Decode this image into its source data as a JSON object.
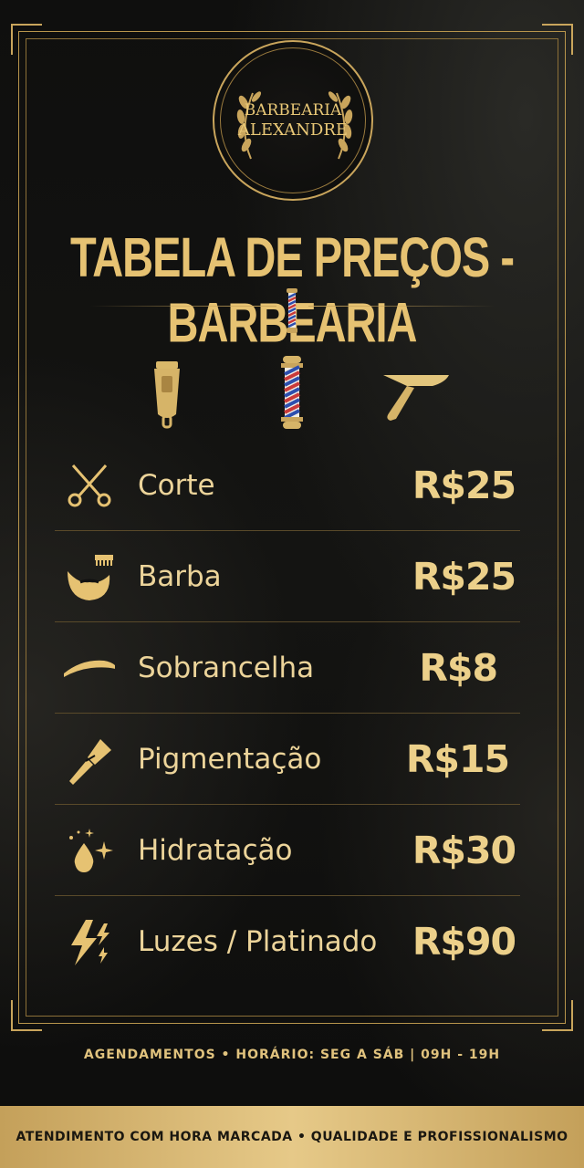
{
  "logo": {
    "line1": "BARBEARIA",
    "line2": "ALEXANDRE"
  },
  "title": "TABELA DE PREÇOS - BARBEARIA",
  "services": [
    {
      "name": "Corte",
      "price": "R$25",
      "icon": "scissors-icon"
    },
    {
      "name": "Barba",
      "price": "R$25",
      "icon": "beard-comb-icon"
    },
    {
      "name": "Sobrancelha",
      "price": "R$8",
      "icon": "eyebrow-icon"
    },
    {
      "name": "Pigmentação",
      "price": "R$15",
      "icon": "brush-icon"
    },
    {
      "name": "Hidratação",
      "price": "R$30",
      "icon": "droplet-sparkle-icon"
    },
    {
      "name": "Luzes / Platinado",
      "price": "R$90",
      "icon": "lightning-icon"
    }
  ],
  "footer_info": "AGENDAMENTOS • HORÁRIO: SEG A SÁB | 09H - 19H",
  "bottom_bar": "ATENDIMENTO COM HORA MARCADA • QUALIDADE E PROFISSIONALISMO",
  "colors": {
    "gold": "#e6c272",
    "background": "#111110",
    "bar": "#d8b873"
  }
}
